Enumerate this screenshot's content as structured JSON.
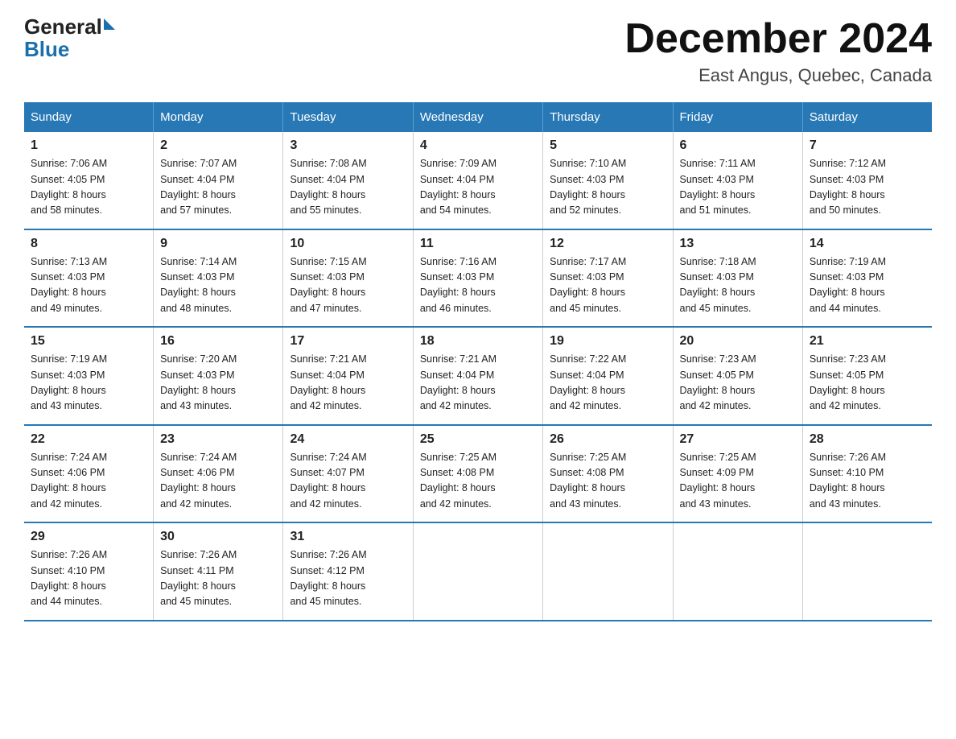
{
  "logo": {
    "text_general": "General",
    "text_blue": "Blue"
  },
  "header": {
    "month": "December 2024",
    "location": "East Angus, Quebec, Canada"
  },
  "weekdays": [
    "Sunday",
    "Monday",
    "Tuesday",
    "Wednesday",
    "Thursday",
    "Friday",
    "Saturday"
  ],
  "weeks": [
    [
      {
        "day": "1",
        "sunrise": "7:06 AM",
        "sunset": "4:05 PM",
        "daylight": "8 hours and 58 minutes."
      },
      {
        "day": "2",
        "sunrise": "7:07 AM",
        "sunset": "4:04 PM",
        "daylight": "8 hours and 57 minutes."
      },
      {
        "day": "3",
        "sunrise": "7:08 AM",
        "sunset": "4:04 PM",
        "daylight": "8 hours and 55 minutes."
      },
      {
        "day": "4",
        "sunrise": "7:09 AM",
        "sunset": "4:04 PM",
        "daylight": "8 hours and 54 minutes."
      },
      {
        "day": "5",
        "sunrise": "7:10 AM",
        "sunset": "4:03 PM",
        "daylight": "8 hours and 52 minutes."
      },
      {
        "day": "6",
        "sunrise": "7:11 AM",
        "sunset": "4:03 PM",
        "daylight": "8 hours and 51 minutes."
      },
      {
        "day": "7",
        "sunrise": "7:12 AM",
        "sunset": "4:03 PM",
        "daylight": "8 hours and 50 minutes."
      }
    ],
    [
      {
        "day": "8",
        "sunrise": "7:13 AM",
        "sunset": "4:03 PM",
        "daylight": "8 hours and 49 minutes."
      },
      {
        "day": "9",
        "sunrise": "7:14 AM",
        "sunset": "4:03 PM",
        "daylight": "8 hours and 48 minutes."
      },
      {
        "day": "10",
        "sunrise": "7:15 AM",
        "sunset": "4:03 PM",
        "daylight": "8 hours and 47 minutes."
      },
      {
        "day": "11",
        "sunrise": "7:16 AM",
        "sunset": "4:03 PM",
        "daylight": "8 hours and 46 minutes."
      },
      {
        "day": "12",
        "sunrise": "7:17 AM",
        "sunset": "4:03 PM",
        "daylight": "8 hours and 45 minutes."
      },
      {
        "day": "13",
        "sunrise": "7:18 AM",
        "sunset": "4:03 PM",
        "daylight": "8 hours and 45 minutes."
      },
      {
        "day": "14",
        "sunrise": "7:19 AM",
        "sunset": "4:03 PM",
        "daylight": "8 hours and 44 minutes."
      }
    ],
    [
      {
        "day": "15",
        "sunrise": "7:19 AM",
        "sunset": "4:03 PM",
        "daylight": "8 hours and 43 minutes."
      },
      {
        "day": "16",
        "sunrise": "7:20 AM",
        "sunset": "4:03 PM",
        "daylight": "8 hours and 43 minutes."
      },
      {
        "day": "17",
        "sunrise": "7:21 AM",
        "sunset": "4:04 PM",
        "daylight": "8 hours and 42 minutes."
      },
      {
        "day": "18",
        "sunrise": "7:21 AM",
        "sunset": "4:04 PM",
        "daylight": "8 hours and 42 minutes."
      },
      {
        "day": "19",
        "sunrise": "7:22 AM",
        "sunset": "4:04 PM",
        "daylight": "8 hours and 42 minutes."
      },
      {
        "day": "20",
        "sunrise": "7:23 AM",
        "sunset": "4:05 PM",
        "daylight": "8 hours and 42 minutes."
      },
      {
        "day": "21",
        "sunrise": "7:23 AM",
        "sunset": "4:05 PM",
        "daylight": "8 hours and 42 minutes."
      }
    ],
    [
      {
        "day": "22",
        "sunrise": "7:24 AM",
        "sunset": "4:06 PM",
        "daylight": "8 hours and 42 minutes."
      },
      {
        "day": "23",
        "sunrise": "7:24 AM",
        "sunset": "4:06 PM",
        "daylight": "8 hours and 42 minutes."
      },
      {
        "day": "24",
        "sunrise": "7:24 AM",
        "sunset": "4:07 PM",
        "daylight": "8 hours and 42 minutes."
      },
      {
        "day": "25",
        "sunrise": "7:25 AM",
        "sunset": "4:08 PM",
        "daylight": "8 hours and 42 minutes."
      },
      {
        "day": "26",
        "sunrise": "7:25 AM",
        "sunset": "4:08 PM",
        "daylight": "8 hours and 43 minutes."
      },
      {
        "day": "27",
        "sunrise": "7:25 AM",
        "sunset": "4:09 PM",
        "daylight": "8 hours and 43 minutes."
      },
      {
        "day": "28",
        "sunrise": "7:26 AM",
        "sunset": "4:10 PM",
        "daylight": "8 hours and 43 minutes."
      }
    ],
    [
      {
        "day": "29",
        "sunrise": "7:26 AM",
        "sunset": "4:10 PM",
        "daylight": "8 hours and 44 minutes."
      },
      {
        "day": "30",
        "sunrise": "7:26 AM",
        "sunset": "4:11 PM",
        "daylight": "8 hours and 45 minutes."
      },
      {
        "day": "31",
        "sunrise": "7:26 AM",
        "sunset": "4:12 PM",
        "daylight": "8 hours and 45 minutes."
      },
      null,
      null,
      null,
      null
    ]
  ],
  "labels": {
    "sunrise": "Sunrise:",
    "sunset": "Sunset:",
    "daylight": "Daylight:"
  }
}
